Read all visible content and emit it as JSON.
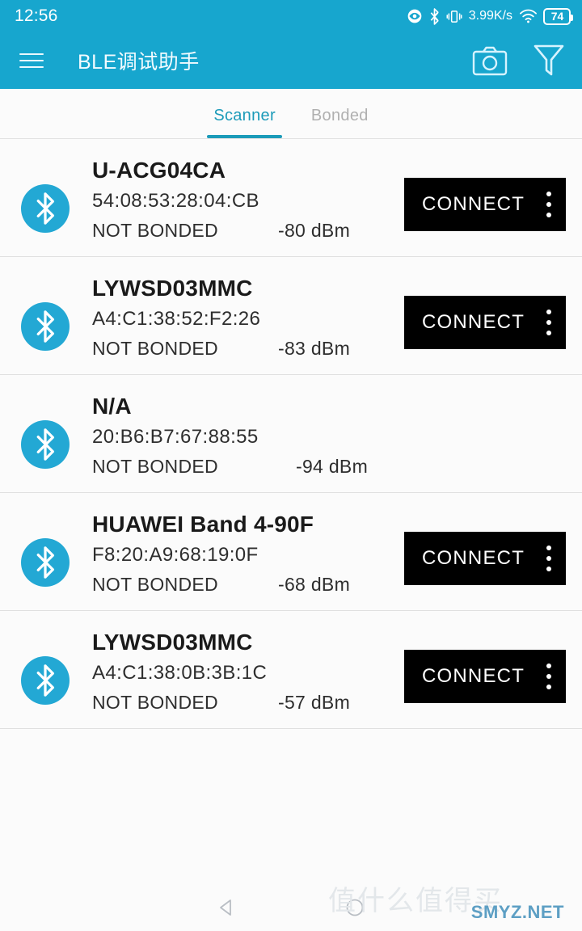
{
  "statusbar": {
    "clock": "12:56",
    "network_speed": "3.99K/s",
    "battery_level": "74",
    "icons": [
      "eye-icon",
      "bluetooth-icon",
      "vibrate-icon",
      "wifi-icon",
      "battery-icon"
    ]
  },
  "appbar": {
    "menu_icon": "hamburger-menu-icon",
    "title": "BLE调试助手",
    "camera_icon": "camera-icon",
    "filter_icon": "filter-funnel-icon"
  },
  "tabs": [
    {
      "label": "Scanner",
      "active": true
    },
    {
      "label": "Bonded",
      "active": false
    }
  ],
  "colors": {
    "primary": "#17a6ce",
    "accent": "#1c9bb9",
    "avatar": "#23a8d4",
    "button": "#000000",
    "background": "#fbfbfb"
  },
  "labels": {
    "connect": "CONNECT",
    "overflow": "more-options"
  },
  "devices": [
    {
      "name": "U-ACG04CA",
      "address": "54:08:53:28:04:CB",
      "bond_state": "NOT BONDED",
      "rssi": "-80 dBm",
      "has_connect": true
    },
    {
      "name": "LYWSD03MMC",
      "address": "A4:C1:38:52:F2:26",
      "bond_state": "NOT BONDED",
      "rssi": "-83 dBm",
      "has_connect": true
    },
    {
      "name": "N/A",
      "address": "20:B6:B7:67:88:55",
      "bond_state": "NOT BONDED",
      "rssi": "-94 dBm",
      "has_connect": false
    },
    {
      "name": "HUAWEI Band 4-90F",
      "address": "F8:20:A9:68:19:0F",
      "bond_state": "NOT BONDED",
      "rssi": "-68 dBm",
      "has_connect": true
    },
    {
      "name": "LYWSD03MMC",
      "address": "A4:C1:38:0B:3B:1C",
      "bond_state": "NOT BONDED",
      "rssi": "-57 dBm",
      "has_connect": true
    }
  ],
  "navbar": {
    "back_icon": "back-triangle-icon",
    "home_icon": "home-circle-icon"
  },
  "watermark": {
    "cn": "值什么值得买",
    "en": "SMYZ.NET"
  }
}
